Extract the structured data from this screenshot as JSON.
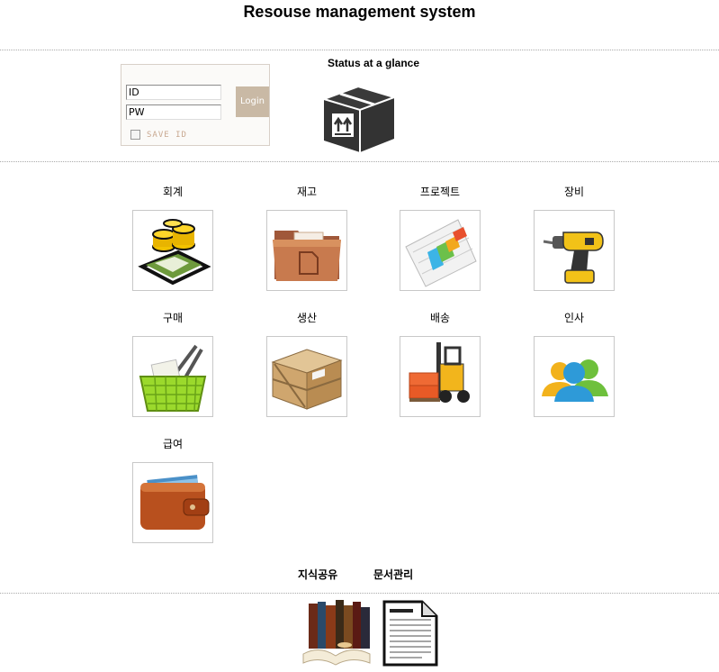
{
  "header": {
    "title": "Resouse management system"
  },
  "login": {
    "id_value": "ID",
    "pw_value": "PW",
    "login_label": "Login",
    "save_id_label": "SAVE ID"
  },
  "status": {
    "title": "Status at a glance",
    "icon": "box-icon"
  },
  "modules": [
    {
      "label": "회계",
      "icon": "money-icon"
    },
    {
      "label": "재고",
      "icon": "folder-icon"
    },
    {
      "label": "프로젝트",
      "icon": "gantt-chart-icon"
    },
    {
      "label": "장비",
      "icon": "drill-icon"
    },
    {
      "label": "구매",
      "icon": "basket-icon"
    },
    {
      "label": "생산",
      "icon": "crate-icon"
    },
    {
      "label": "배송",
      "icon": "forklift-icon"
    },
    {
      "label": "인사",
      "icon": "people-icon"
    },
    {
      "label": "급여",
      "icon": "wallet-icon"
    }
  ],
  "bottom_links": [
    {
      "label": "지식공유",
      "icon": "books-icon"
    },
    {
      "label": "문서관리",
      "icon": "document-icon"
    }
  ]
}
